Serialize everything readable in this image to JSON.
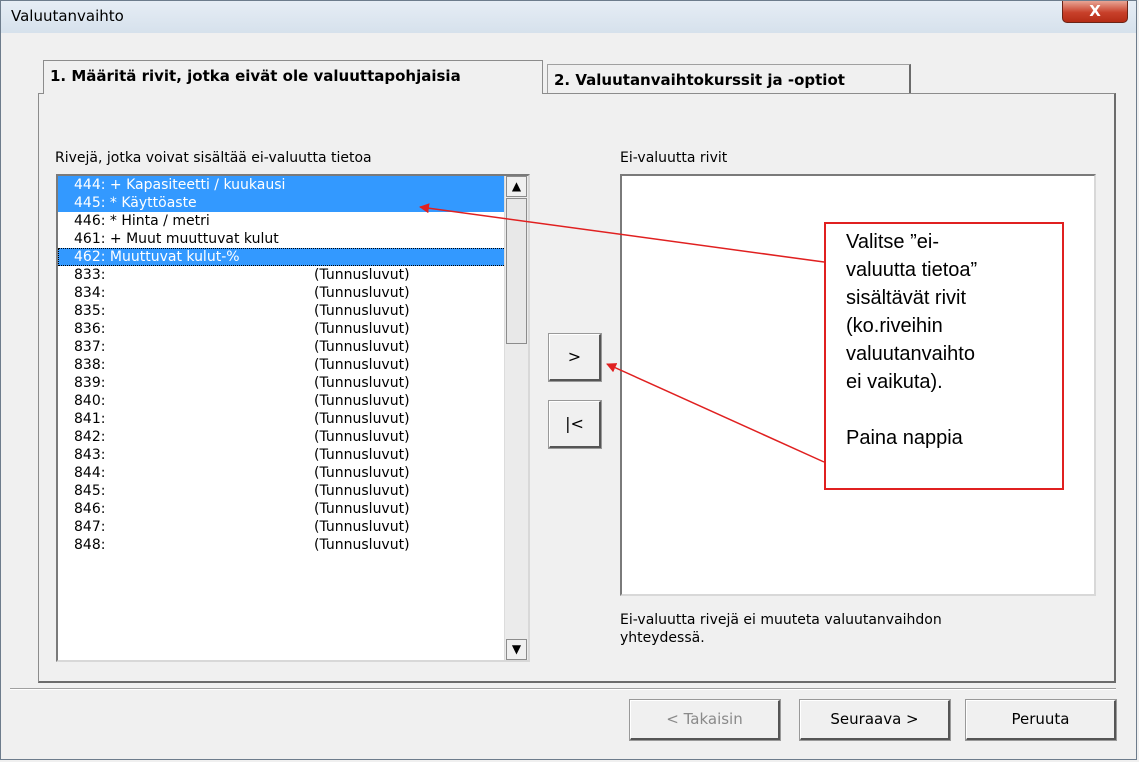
{
  "window": {
    "title": "Valuutanvaihto",
    "close_label": "X"
  },
  "tabs": [
    {
      "label": "1. Määritä rivit, jotka eivät ole valuuttapohjaisia"
    },
    {
      "label": "2. Valuutanvaihtokurssit ja -optiot"
    }
  ],
  "left_list": {
    "label": "Rivejä, jotka voivat sisältää ei-valuutta tietoa",
    "rows": [
      {
        "num": "444:",
        "text": "+ Kapasiteetti / kuukausi",
        "inline": true,
        "selected": true
      },
      {
        "num": "445:",
        "text": "* Käyttöaste",
        "inline": true,
        "selected": true
      },
      {
        "num": "446:",
        "text": "* Hinta / metri",
        "inline": true,
        "selected": false
      },
      {
        "num": "461:",
        "text": "+ Muut muuttuvat kulut",
        "inline": true,
        "selected": false
      },
      {
        "num": "462:",
        "text": "Muuttuvat kulut-%",
        "inline": true,
        "selected": true,
        "focus": true
      },
      {
        "num": "833:",
        "text": "(Tunnusluvut)"
      },
      {
        "num": "834:",
        "text": "(Tunnusluvut)"
      },
      {
        "num": "835:",
        "text": "(Tunnusluvut)"
      },
      {
        "num": "836:",
        "text": "(Tunnusluvut)"
      },
      {
        "num": "837:",
        "text": "(Tunnusluvut)"
      },
      {
        "num": "838:",
        "text": "(Tunnusluvut)"
      },
      {
        "num": "839:",
        "text": "(Tunnusluvut)"
      },
      {
        "num": "840:",
        "text": "(Tunnusluvut)"
      },
      {
        "num": "841:",
        "text": "(Tunnusluvut)"
      },
      {
        "num": "842:",
        "text": "(Tunnusluvut)"
      },
      {
        "num": "843:",
        "text": "(Tunnusluvut)"
      },
      {
        "num": "844:",
        "text": "(Tunnusluvut)"
      },
      {
        "num": "845:",
        "text": "(Tunnusluvut)"
      },
      {
        "num": "846:",
        "text": "(Tunnusluvut)"
      },
      {
        "num": "847:",
        "text": "(Tunnusluvut)"
      },
      {
        "num": "848:",
        "text": "(Tunnusluvut)"
      }
    ]
  },
  "right_list": {
    "label": "Ei-valuutta rivit",
    "note_line1": "Ei-valuutta rivejä ei muuteta valuutanvaihdon",
    "note_line2": "yhteydessä."
  },
  "move_buttons": {
    "add_label": ">",
    "remove_all_label": "|<"
  },
  "callout": {
    "lines": [
      "Valitse ”ei-",
      "valuutta tietoa”",
      "sisältävät rivit",
      "(ko.riveihin",
      "valuutanvaihto",
      "ei vaikuta)."
    ],
    "action": "Paina nappia"
  },
  "footer": {
    "back_label": "< Takaisin",
    "next_label": "Seuraava >",
    "cancel_label": "Peruuta"
  },
  "colors": {
    "selection": "#3399ff",
    "callout_border": "#e02020",
    "close_button": "#c8402a"
  }
}
